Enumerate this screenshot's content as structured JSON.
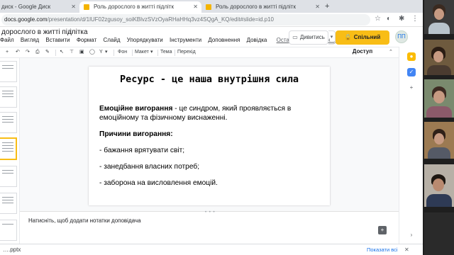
{
  "browser": {
    "tabs": [
      {
        "title": "диск - Google Диск",
        "active": false
      },
      {
        "title": "Роль дорослого в житті підлітк",
        "active": true
      },
      {
        "title": "Роль дорослого в житті підлітк",
        "active": false
      }
    ],
    "new_tab": "+",
    "url_host": "docs.google.com",
    "url_path": "/presentation/d/1lUF02zgusoy_soiKBlvzSVzOyaRHaHHq3vz4SQgA_KQ/edit#slide=id.p10"
  },
  "doc": {
    "title": "дорослого в житті підлітка",
    "menu": [
      "Файл",
      "Вигляд",
      "Вставити",
      "Формат",
      "Слайд",
      "Упорядкувати",
      "Інструменти",
      "Доповнення",
      "Довідка"
    ],
    "last_edit": "Остання зміна: анон…",
    "present_label": "Дивитись",
    "share_label": "Спільний Доступ",
    "avatar_text": "ПП"
  },
  "toolbar": {
    "text_tool": "Y",
    "background": "Фон",
    "layout": "Макет",
    "theme": "Тема",
    "transition": "Перехід"
  },
  "slide": {
    "title": "Ресурс - це наша внутрішня сила",
    "burnout_term": "Емоційне вигорання",
    "burnout_def_1": " - це синдром, який проявляється в",
    "burnout_def_2": "емоційному та фізичному виснаженні.",
    "causes_heading": "Причини вигорання:",
    "causes": [
      "- бажання врятувати світ;",
      "- занедбання власних потреб;",
      "- заборона на висловлення емоцій."
    ]
  },
  "notes": {
    "placeholder": "Натисніть, щоб додати нотатки доповідача"
  },
  "downloads": {
    "file": "….pptx",
    "show_all": "Показати всі"
  }
}
